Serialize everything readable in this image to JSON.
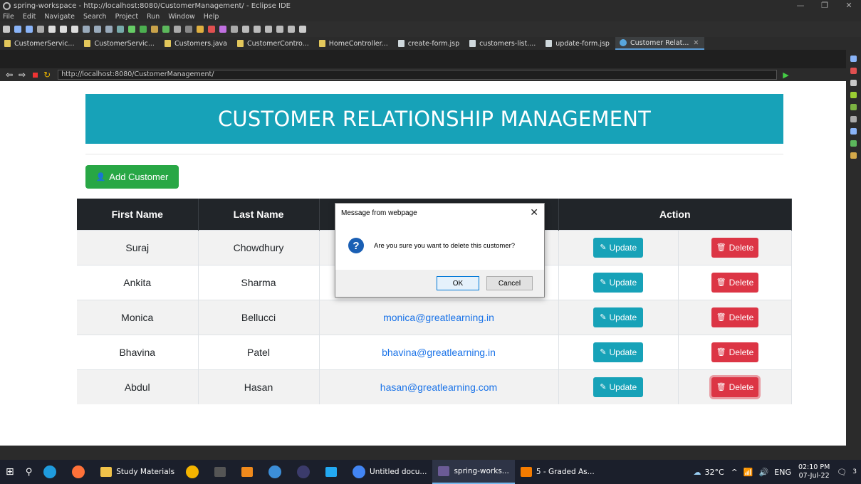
{
  "window": {
    "title": "spring-workspace - http://localhost:8080/CustomerManagement/ - Eclipse IDE"
  },
  "menu": [
    "File",
    "Edit",
    "Navigate",
    "Search",
    "Project",
    "Run",
    "Window",
    "Help"
  ],
  "tabs": [
    {
      "label": "CustomerServic...",
      "icon": "java-file-icon"
    },
    {
      "label": "CustomerServic...",
      "icon": "java-file-icon"
    },
    {
      "label": "Customers.java",
      "icon": "java-file-icon"
    },
    {
      "label": "CustomerContro...",
      "icon": "java-file-icon"
    },
    {
      "label": "HomeController...",
      "icon": "java-file-icon"
    },
    {
      "label": "create-form.jsp",
      "icon": "jsp-file-icon"
    },
    {
      "label": "customers-list....",
      "icon": "jsp-file-icon"
    },
    {
      "label": "update-form.jsp",
      "icon": "jsp-file-icon"
    },
    {
      "label": "Customer Relat...",
      "icon": "globe-icon",
      "active": true
    }
  ],
  "browser": {
    "url": "http://localhost:8080/CustomerManagement/"
  },
  "page": {
    "banner_title": "CUSTOMER RELATIONSHIP MANAGEMENT",
    "add_button_label": "Add Customer",
    "columns": {
      "first_name": "First Name",
      "last_name": "Last Name",
      "action": "Action"
    },
    "update_label": "Update",
    "delete_label": "Delete",
    "rows": [
      {
        "first": "Suraj",
        "last": "Chowdhury",
        "email": ""
      },
      {
        "first": "Ankita",
        "last": "Sharma",
        "email": ""
      },
      {
        "first": "Monica",
        "last": "Bellucci",
        "email": "monica@greatlearning.in"
      },
      {
        "first": "Bhavina",
        "last": "Patel",
        "email": "bhavina@greatlearning.in"
      },
      {
        "first": "Abdul",
        "last": "Hasan",
        "email": "hasan@greatlearning.com"
      }
    ]
  },
  "dialog": {
    "title": "Message from webpage",
    "message": "Are you sure you want to delete this customer?",
    "ok_label": "OK",
    "cancel_label": "Cancel"
  },
  "taskbar": {
    "items": [
      {
        "label": "Study Materials",
        "icon": "folder-icon"
      },
      {
        "label": "Untitled docu...",
        "icon": "chrome-icon"
      },
      {
        "label": "spring-works...",
        "icon": "eclipse-icon",
        "active": true
      },
      {
        "label": "5 - Graded As...",
        "icon": "app-icon"
      }
    ],
    "weather": "32°C",
    "language": "ENG",
    "time": "02:10 PM",
    "date": "07-Jul-22",
    "notifications": "3"
  }
}
